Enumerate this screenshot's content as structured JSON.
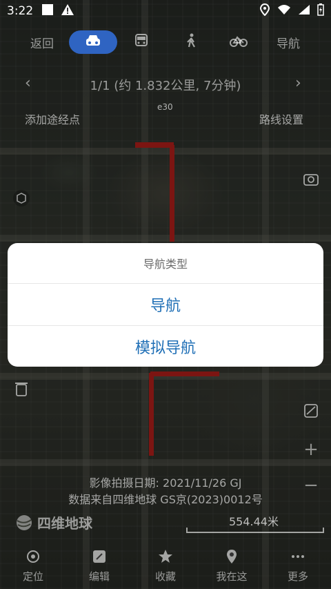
{
  "status": {
    "time": "3:22"
  },
  "modes": {
    "back": "返回",
    "navigate": "导航"
  },
  "route_info": "1/1  (约 1.832公里, 7分钟)",
  "actions": {
    "add_waypoint": "添加途经点",
    "route_settings": "路线设置"
  },
  "map_labels": {
    "road_code": "e30"
  },
  "dialog": {
    "title": "导航类型",
    "options": [
      "导航",
      "模拟导航"
    ]
  },
  "credits": {
    "capture_date": "影像拍摄日期: 2021/11/26 GJ",
    "source": "数据来自四维地球 GS京(2023)0012号"
  },
  "brand": "四维地球",
  "scale": "554.44米",
  "bottom_nav": [
    "定位",
    "编辑",
    "收藏",
    "我在这",
    "更多"
  ],
  "colors": {
    "accent": "#2f64c2",
    "dialog_option": "#1f6fb6",
    "route": "#c8231e"
  }
}
